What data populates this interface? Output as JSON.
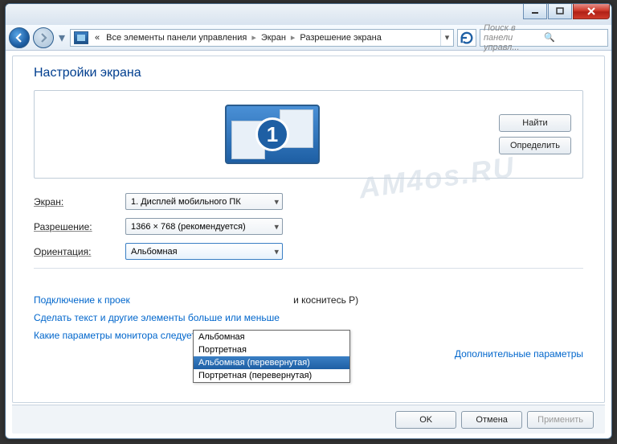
{
  "titlebar": {
    "min": "—",
    "max": "▭",
    "close": "✕"
  },
  "nav": {
    "breadcrumbs": {
      "prefix": "«",
      "b1": "Все элементы панели управления",
      "b2": "Экран",
      "b3": "Разрешение экрана"
    },
    "search_placeholder": "Поиск в панели управл..."
  },
  "page": {
    "title": "Настройки экрана",
    "monitor_number": "1",
    "find_btn": "Найти",
    "detect_btn": "Определить",
    "watermark": "AM4os.RU"
  },
  "form": {
    "screen_label": "Экран:",
    "screen_value": "1. Дисплей мобильного ПК",
    "res_label": "Разрешение:",
    "res_value": "1366 × 768 (рекомендуется)",
    "orient_label": "Ориентация:",
    "orient_value": "Альбомная",
    "orient_options": [
      "Альбомная",
      "Портретная",
      "Альбомная (перевернутая)",
      "Портретная (перевернутая)"
    ],
    "orient_highlight_index": 2
  },
  "links": {
    "advanced": "Дополнительные параметры",
    "projector": "Подключение к проек",
    "projector_suffix": "и коснитесь P)",
    "textsize": "Сделать текст и другие элементы больше или меньше",
    "which": "Какие параметры монитора следует выбрать?"
  },
  "buttons": {
    "ok": "OK",
    "cancel": "Отмена",
    "apply": "Применить"
  }
}
